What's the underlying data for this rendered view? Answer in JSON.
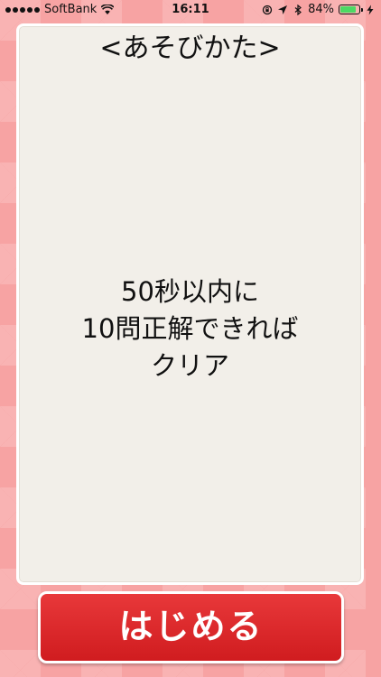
{
  "status_bar": {
    "carrier": "SoftBank",
    "time": "16:11",
    "battery_percent": "84%",
    "battery_level": 0.84,
    "battery_color": "#4cd964",
    "signal_bars": 5,
    "icons": [
      "wifi-icon",
      "rotation-lock-icon",
      "location-icon",
      "bluetooth-icon",
      "charging-icon"
    ]
  },
  "card": {
    "title": "<あそびかた>",
    "instructions": [
      "50秒以内に",
      "10問正解できれば",
      "クリア"
    ]
  },
  "start_button": {
    "label": "はじめる",
    "color": "#e02b2d"
  }
}
